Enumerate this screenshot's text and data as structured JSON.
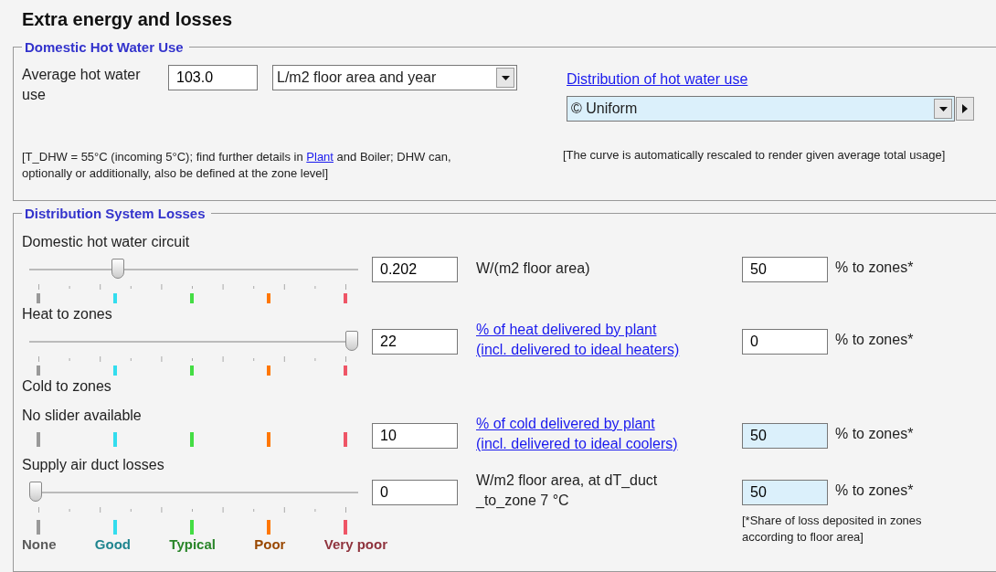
{
  "title": "Extra energy and losses",
  "hot_water": {
    "legend": "Domestic Hot Water Use",
    "label": "Average hot water use",
    "value": "103.0",
    "unit": "L/m2 floor area and year",
    "note_parts": [
      {
        "kind": "text",
        "text": "[T_DHW = 55°C (incoming 5°C); find further details in "
      },
      {
        "kind": "link",
        "text": "Plant"
      },
      {
        "kind": "text",
        "text": " and Boiler; DHW can, optionally or additionally, also be defined at the zone level]"
      }
    ],
    "distribution_link": "Distribution of hot water use",
    "distribution": "© Uniform",
    "distribution_note": "[The curve is automatically rescaled to render given average total usage]"
  },
  "losses": {
    "legend": "Distribution System Losses",
    "rows": [
      {
        "label": "Domestic hot water circuit",
        "kind": "slider",
        "level": 0.26,
        "value": "0.202",
        "unit": {
          "kind": "text",
          "lines": [
            "W/(m2 floor area)"
          ]
        },
        "share": "50",
        "shaded": false,
        "share_label": "% to zones*"
      },
      {
        "label": "Heat to zones",
        "kind": "slider",
        "level": 1,
        "value": "22",
        "unit": {
          "kind": "link",
          "lines": [
            "% of heat delivered by plant",
            "(incl. delivered to ideal heaters)"
          ]
        },
        "share": "0",
        "shaded": false,
        "share_label": "% to zones*"
      },
      {
        "label": "Cold to zones",
        "kind": "none",
        "note": "No slider available",
        "value": "10",
        "unit": {
          "kind": "link",
          "lines": [
            "% of cold delivered by plant",
            "(incl. delivered to ideal coolers)"
          ]
        },
        "share": "50",
        "shaded": true,
        "share_label": "% to zones*"
      },
      {
        "label": "Supply air duct losses",
        "kind": "slider",
        "level": 0,
        "value": "0",
        "unit": {
          "kind": "text",
          "lines": [
            "W/m2 floor area, at dT_duct",
            "_to_zone 7 °C"
          ]
        },
        "share": "50",
        "shaded": true,
        "share_label": "% to zones*"
      }
    ],
    "scale": [
      {
        "label": "None",
        "color": "#999999"
      },
      {
        "label": "Good",
        "color": "#33ddee"
      },
      {
        "label": "Typical",
        "color": "#44dd44"
      },
      {
        "label": "Poor",
        "color": "#ff7700"
      },
      {
        "label": "Very poor",
        "color": "#ee5566"
      }
    ],
    "footnote": "[*Share of loss deposited in zones according to floor area]"
  }
}
